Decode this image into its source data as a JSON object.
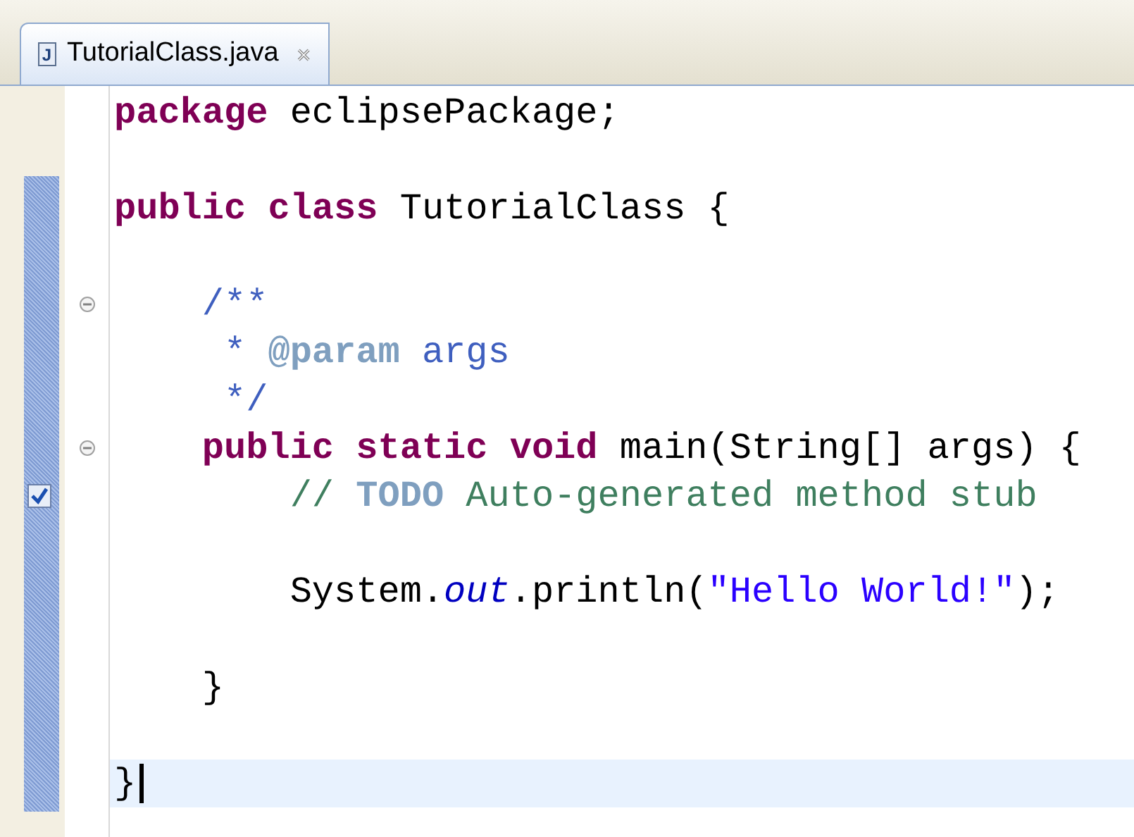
{
  "tab": {
    "icon_text": "J",
    "label": "TutorialClass.java",
    "selected": true
  },
  "lines": [
    {
      "kind": "code",
      "tokens": [
        {
          "kind": "keyword",
          "text": "package"
        },
        {
          "kind": "plain",
          "text": " eclipsePackage;"
        }
      ]
    },
    {
      "kind": "blank"
    },
    {
      "kind": "code",
      "tokens": [
        {
          "kind": "keyword",
          "text": "public class"
        },
        {
          "kind": "plain",
          "text": " TutorialClass {"
        }
      ]
    },
    {
      "kind": "blank"
    },
    {
      "kind": "code",
      "fold": true,
      "tokens": [
        {
          "kind": "javadoc",
          "text": "    /**"
        }
      ]
    },
    {
      "kind": "code",
      "tokens": [
        {
          "kind": "javadoc",
          "text": "     * "
        },
        {
          "kind": "javadoc_tag",
          "text": "@param"
        },
        {
          "kind": "javadoc",
          "text": " args"
        }
      ]
    },
    {
      "kind": "code",
      "tokens": [
        {
          "kind": "javadoc",
          "text": "     */"
        }
      ]
    },
    {
      "kind": "code",
      "fold": true,
      "tokens": [
        {
          "kind": "keyword",
          "text": "    public static void"
        },
        {
          "kind": "plain",
          "text": " main(String[] args) {"
        }
      ]
    },
    {
      "kind": "code",
      "task": true,
      "tokens": [
        {
          "kind": "comment",
          "text": "        // "
        },
        {
          "kind": "task_tag",
          "text": "TODO"
        },
        {
          "kind": "comment",
          "text": " Auto-generated method stub"
        }
      ]
    },
    {
      "kind": "blank"
    },
    {
      "kind": "code",
      "tokens": [
        {
          "kind": "plain",
          "text": "        System."
        },
        {
          "kind": "static_field",
          "text": "out"
        },
        {
          "kind": "plain",
          "text": ".println("
        },
        {
          "kind": "string",
          "text": "\"Hello World!\""
        },
        {
          "kind": "plain",
          "text": ");"
        }
      ]
    },
    {
      "kind": "blank"
    },
    {
      "kind": "code",
      "tokens": [
        {
          "kind": "plain",
          "text": "    }"
        }
      ]
    },
    {
      "kind": "blank"
    },
    {
      "kind": "code",
      "current": true,
      "tokens": [
        {
          "kind": "plain",
          "text": "}"
        }
      ]
    }
  ]
}
